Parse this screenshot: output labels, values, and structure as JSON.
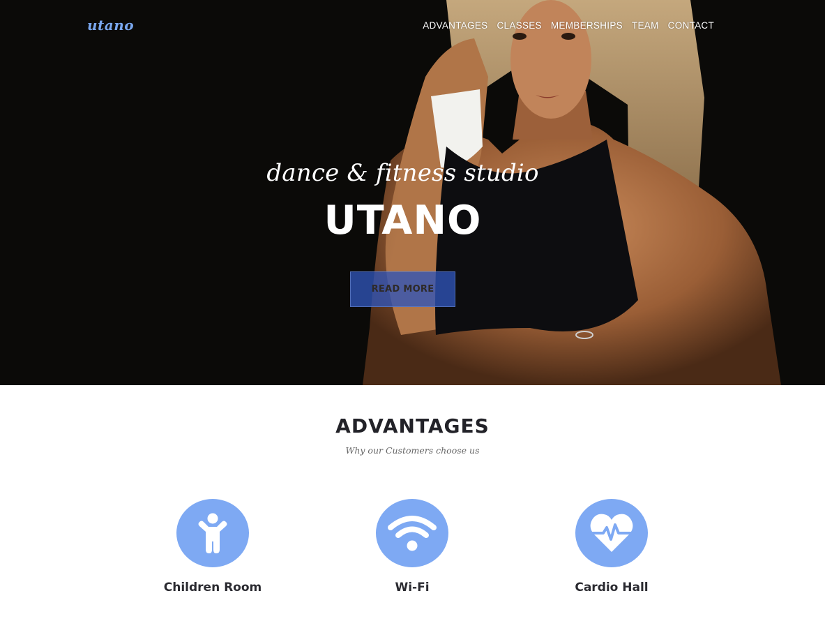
{
  "brand": {
    "logo_text": "utano",
    "accent_color": "#7ea9f3"
  },
  "nav": {
    "items": [
      {
        "label": "ADVANTAGES"
      },
      {
        "label": "CLASSES"
      },
      {
        "label": "MEMBERSHIPS"
      },
      {
        "label": "TEAM"
      },
      {
        "label": "CONTACT"
      }
    ]
  },
  "hero": {
    "tagline": "dance & fitness studio",
    "title": "UTANO",
    "button_label": "READ MORE"
  },
  "advantages": {
    "title": "ADVANTAGES",
    "subtitle": "Why our Customers choose us",
    "items": [
      {
        "label": "Children Room",
        "icon": "child-icon"
      },
      {
        "label": "Wi-Fi",
        "icon": "wifi-icon"
      },
      {
        "label": "Cardio Hall",
        "icon": "heartbeat-icon"
      }
    ]
  }
}
